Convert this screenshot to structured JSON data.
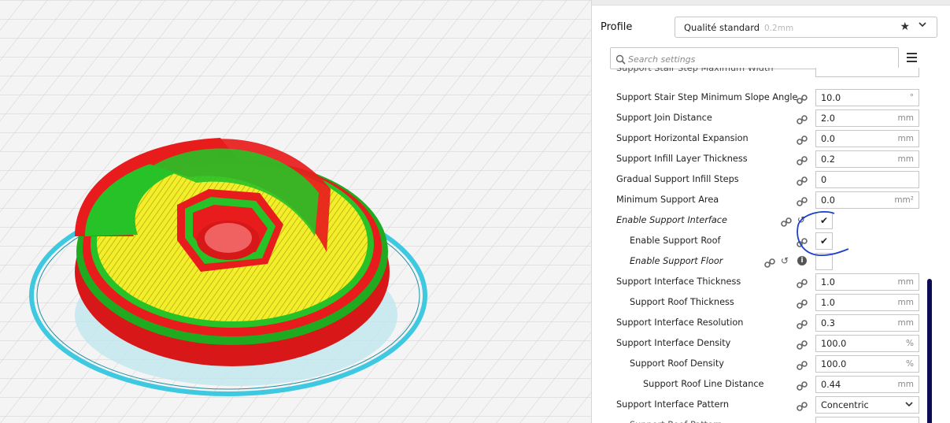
{
  "profile": {
    "label": "Profile",
    "name": "Qualité standard",
    "sub": "0.2mm"
  },
  "search": {
    "placeholder": "Search settings"
  },
  "icons": {
    "star": "star-icon",
    "chevron": "chevron-down-icon",
    "search": "search-icon",
    "menu": "hamburger-menu-icon",
    "link": "link-icon",
    "reset": "reset-icon",
    "info": "info-icon"
  },
  "colors": {
    "accent_scroll": "#0d0d55",
    "annotation": "#1a3fd1"
  },
  "settings": [
    {
      "label": "Support Stair Step Minimum Slope Angle",
      "value": "10.0",
      "unit": "°"
    },
    {
      "label": "Support Join Distance",
      "value": "2.0",
      "unit": "mm"
    },
    {
      "label": "Support Horizontal Expansion",
      "value": "0.0",
      "unit": "mm"
    },
    {
      "label": "Support Infill Layer Thickness",
      "value": "0.2",
      "unit": "mm"
    },
    {
      "label": "Gradual Support Infill Steps",
      "value": "0",
      "unit": ""
    },
    {
      "label": "Minimum Support Area",
      "value": "0.0",
      "unit": "mm²"
    },
    {
      "label": "Enable Support Interface",
      "checked": true
    },
    {
      "label": "Enable Support Roof",
      "checked": true
    },
    {
      "label": "Enable Support Floor",
      "checked": false,
      "info": "i"
    },
    {
      "label": "Support Interface Thickness",
      "value": "1.0",
      "unit": "mm"
    },
    {
      "label": "Support Roof Thickness",
      "value": "1.0",
      "unit": "mm"
    },
    {
      "label": "Support Interface Resolution",
      "value": "0.3",
      "unit": "mm"
    },
    {
      "label": "Support Interface Density",
      "value": "100.0",
      "unit": "%"
    },
    {
      "label": "Support Roof Density",
      "value": "100.0",
      "unit": "%"
    },
    {
      "label": "Support Roof Line Distance",
      "value": "0.44",
      "unit": "mm"
    },
    {
      "label": "Support Interface Pattern",
      "value": "Concentric"
    }
  ]
}
